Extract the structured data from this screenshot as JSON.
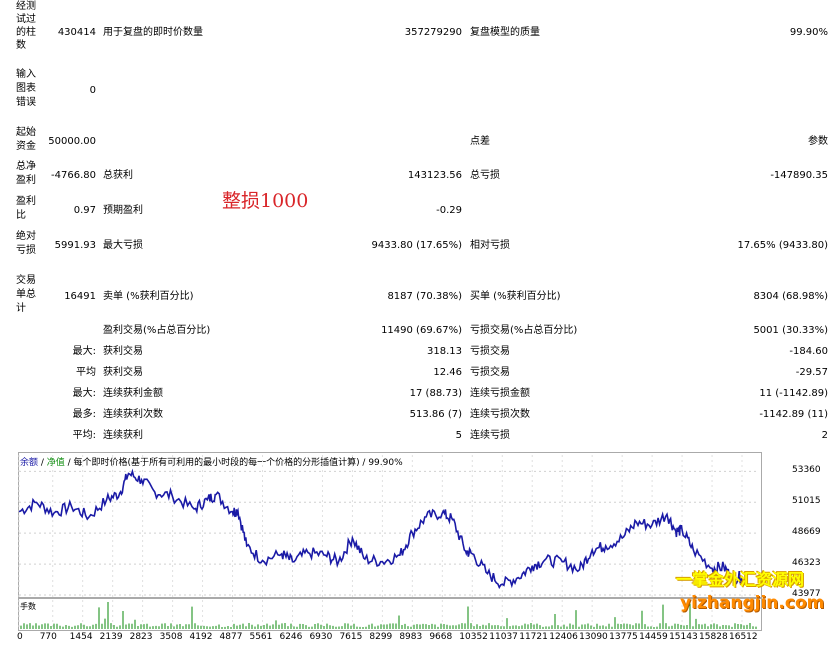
{
  "report": {
    "bars_label": "经测\n试过\n的柱\n数",
    "bars_value": "430414",
    "ticks_label": "用于复盘的即时价数量",
    "ticks_value": "357279290",
    "quality_label": "复盘模型的质量",
    "quality_value": "99.90%",
    "errors_label": "输入\n图表\n错误",
    "errors_value": "0",
    "deposit_label": "起始\n资金",
    "deposit_value": "50000.00",
    "spread_label": "点差",
    "params_label": "参数",
    "net_label": "总净\n盈利",
    "net_value": "-4766.80",
    "gross_profit_label": "总获利",
    "gross_profit_value": "143123.56",
    "gross_loss_label": "总亏损",
    "gross_loss_value": "-147890.35",
    "pf_label": "盈利\n比",
    "pf_value": "0.97",
    "expected_label": "预期盈利",
    "expected_value": "-0.29",
    "abs_dd_label": "绝对\n亏损",
    "abs_dd_value": "5991.93",
    "max_dd_label": "最大亏损",
    "max_dd_value": "9433.80 (17.65%)",
    "rel_dd_label": "相对亏损",
    "rel_dd_value": "17.65% (9433.80)",
    "trades_label": "交易\n单总\n计",
    "trades_value": "16491",
    "short_label": "卖单 (%获利百分比)",
    "short_value": "8187 (70.38%)",
    "long_label": "买单 (%获利百分比)",
    "long_value": "8304 (68.98%)",
    "win_label": "盈利交易(%占总百分比)",
    "win_value": "11490 (69.67%)",
    "loss_label": "亏损交易(%占总百分比)",
    "loss_value": "5001 (30.33%)",
    "max1": "最大:",
    "max_win_label": "获利交易",
    "max_win_value": "318.13",
    "max_loss_label": "亏损交易",
    "max_loss_value": "-184.60",
    "avg1": "平均",
    "avg_win_label": "获利交易",
    "avg_win_value": "12.46",
    "avg_loss_label": "亏损交易",
    "avg_loss_value": "-29.57",
    "max2": "最大:",
    "cons_win_amt_label": "连续获利金额",
    "cons_win_amt_value": "17 (88.73)",
    "cons_loss_amt_label": "连续亏损金额",
    "cons_loss_amt_value": "11 (-1142.89)",
    "most": "最多:",
    "cons_win_cnt_label": "连续获利次数",
    "cons_win_cnt_value": "513.86 (7)",
    "cons_loss_cnt_label": "连续亏损次数",
    "cons_loss_cnt_value": "-1142.89 (11)",
    "avg2": "平均:",
    "cons_wins_label": "连续获利",
    "cons_wins_value": "5",
    "cons_losses_label": "连续亏损",
    "cons_losses_value": "2"
  },
  "stamp_text": "整损1000",
  "chart_legend": {
    "balance": "余额",
    "sep1": " / ",
    "equity": "净值",
    "rest": " / 每个即时价格(基于所有可利用的最小时段的每一个价格的分形插值计算) / 99.90%"
  },
  "volume_label": "手数",
  "watermark": {
    "line1": "一掌金外汇资源网",
    "line2": "yizhangjin.com"
  },
  "colors": {
    "balance": "#1a1aa6",
    "volume": "#0a8a0a"
  },
  "chart_data": {
    "type": "line",
    "ylim": [
      43977,
      54600
    ],
    "yticks": [
      "53360",
      "51015",
      "48669",
      "46323",
      "43977"
    ],
    "xlim": [
      0,
      16900
    ],
    "xticks": [
      "0",
      "770",
      "1454",
      "2139",
      "2823",
      "3508",
      "4192",
      "4877",
      "5561",
      "6246",
      "6930",
      "7615",
      "8299",
      "8983",
      "9668",
      "10352",
      "11037",
      "11721",
      "12406",
      "13090",
      "13775",
      "14459",
      "15143",
      "15828",
      "16512"
    ],
    "series": [
      {
        "name": "余额",
        "x": [
          0,
          400,
          800,
          1200,
          1600,
          2000,
          2300,
          2500,
          2800,
          3100,
          3500,
          4000,
          4300,
          4500,
          4877,
          5000,
          5200,
          5561,
          6000,
          6246,
          6600,
          7000,
          7300,
          7615,
          7900,
          8299,
          8700,
          8983,
          9300,
          9668,
          9900,
          10200,
          10352,
          10700,
          11037,
          11400,
          11721,
          12000,
          12406,
          12800,
          13090,
          13400,
          13775,
          14100,
          14459,
          14800,
          15000,
          15143,
          15400,
          15828,
          16100,
          16300,
          16512
        ],
        "y": [
          50300,
          51000,
          50200,
          50700,
          49900,
          51200,
          51700,
          53200,
          52700,
          51800,
          51500,
          50500,
          51200,
          51600,
          50300,
          50400,
          47700,
          46600,
          47100,
          46500,
          47200,
          47000,
          46500,
          48300,
          46700,
          46500,
          47000,
          48700,
          49900,
          50200,
          49700,
          47300,
          47100,
          45600,
          44800,
          45300,
          46200,
          46600,
          46500,
          45900,
          47400,
          47700,
          48300,
          49500,
          49300,
          50100,
          48800,
          48900,
          47400,
          46000,
          46100,
          45200,
          45400
        ]
      }
    ]
  }
}
